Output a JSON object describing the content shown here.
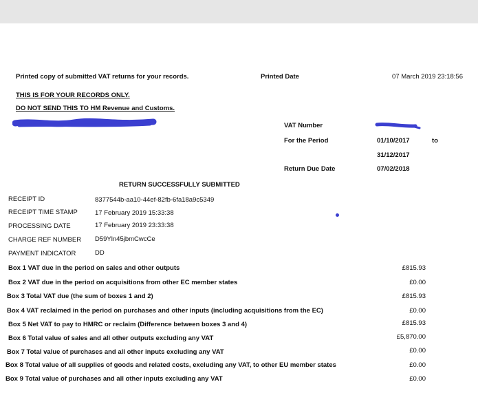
{
  "header": {
    "printed_copy_text": "Printed copy of submitted VAT returns for your records.",
    "printed_date_label": "Printed Date",
    "printed_date_value": "07 March 2019 23:18:56",
    "records_only": "THIS IS FOR YOUR RECORDS ONLY.",
    "do_not_send": "DO NOT SEND THIS TO HM Revenue and Customs."
  },
  "vat_info": {
    "vat_number_label": "VAT Number",
    "period_label": "For the Period",
    "period_start": "01/10/2017",
    "period_to": "to",
    "period_end": "31/12/2017",
    "due_date_label": "Return Due Date",
    "due_date_value": "07/02/2018",
    "redaction_color": "#3b3fd0"
  },
  "submission": {
    "title": "RETURN SUCCESSFULLY SUBMITTED",
    "fields": [
      {
        "label": "RECEIPT ID",
        "value": "8377544b-aa10-44ef-82fb-6fa18a9c5349"
      },
      {
        "label": "RECEIPT TIME STAMP",
        "value": "17 February 2019 15:33:38"
      },
      {
        "label": "PROCESSING DATE",
        "value": "17 February 2019 23:33:38"
      },
      {
        "label": "CHARGE REF NUMBER",
        "value": "D59Yln45jbmCwcCe"
      },
      {
        "label": "PAYMENT INDICATOR",
        "value": "DD"
      }
    ]
  },
  "boxes": [
    {
      "label": "Box 1 VAT due in the period on sales and other outputs",
      "value": "£815.93"
    },
    {
      "label": "Box 2 VAT due in the period on acquisitions from other EC member states",
      "value": "£0.00"
    },
    {
      "label": "Box 3 Total VAT due (the sum of boxes 1 and 2)",
      "value": "£815.93"
    },
    {
      "label": "Box 4 VAT reclaimed in the period on purchases and other inputs (including acquisitions from the EC)",
      "value": "£0.00"
    },
    {
      "label": "Box 5 Net VAT to pay to HMRC or reclaim (Difference between boxes 3 and 4)",
      "value": "£815.93"
    },
    {
      "label": "Box 6 Total value of sales and all other outputs excluding any VAT",
      "value": "£5,870.00"
    },
    {
      "label": "Box 7 Total value of purchases and all other inputs excluding any VAT",
      "value": "£0.00"
    },
    {
      "label": "Box 8 Total value of all supplies of goods and related costs, excluding any VAT, to other EU member states",
      "value": "£0.00"
    },
    {
      "label": "Box 9 Total value of purchases and all other inputs excluding any VAT",
      "value": "£0.00"
    }
  ]
}
